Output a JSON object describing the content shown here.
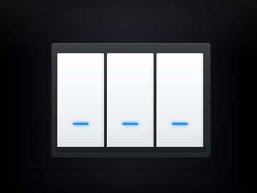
{
  "device": {
    "type": "wall light switch",
    "plate_color": "#000000",
    "frame_color": "#2b2d31",
    "rocker_color": "#f4f5f7",
    "indicator_color": "#2a8fe8"
  },
  "switches": [
    {
      "icon": "led-indicator-icon"
    },
    {
      "icon": "led-indicator-icon"
    },
    {
      "icon": "led-indicator-icon"
    }
  ]
}
